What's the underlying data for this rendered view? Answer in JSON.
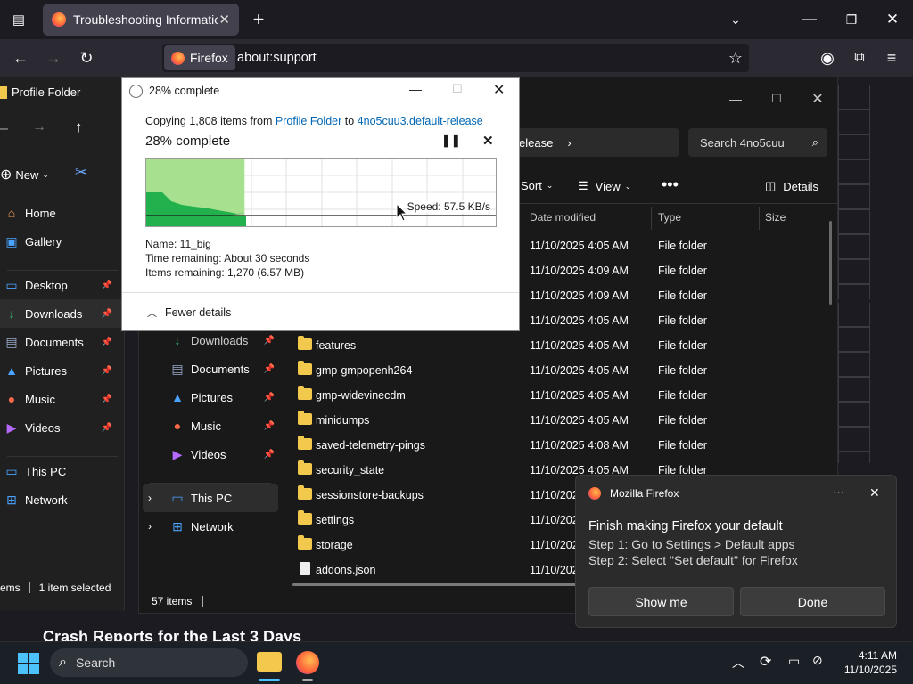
{
  "firefox": {
    "tab_title": "Troubleshooting Information",
    "identity_label": "Firefox",
    "url": "about:support",
    "page_heading": "Crash Reports for the Last 3 Days"
  },
  "explorer_back": {
    "title": "Profile Folder",
    "new_label": "New",
    "nav": [
      {
        "label": "Home",
        "icon": "home-icon"
      },
      {
        "label": "Gallery",
        "icon": "gallery-icon"
      },
      {
        "label": "Desktop",
        "icon": "desktop-icon"
      },
      {
        "label": "Downloads",
        "icon": "download-icon"
      },
      {
        "label": "Documents",
        "icon": "documents-icon"
      },
      {
        "label": "Pictures",
        "icon": "pictures-icon"
      },
      {
        "label": "Music",
        "icon": "music-icon"
      },
      {
        "label": "Videos",
        "icon": "videos-icon"
      },
      {
        "label": "This PC",
        "icon": "pc-icon"
      },
      {
        "label": "Network",
        "icon": "network-icon"
      }
    ],
    "status_items": "ems",
    "status_selected": "1 item selected"
  },
  "explorer_front": {
    "breadcrumb_tail": "elease",
    "search_placeholder": "Search 4no5cuu",
    "sort_label": "Sort",
    "view_label": "View",
    "details_label": "Details",
    "columns": {
      "date": "Date modified",
      "type": "Type",
      "size": "Size"
    },
    "tree": [
      {
        "label": "Downloads",
        "icon": "download-icon"
      },
      {
        "label": "Documents",
        "icon": "documents-icon"
      },
      {
        "label": "Pictures",
        "icon": "pictures-icon"
      },
      {
        "label": "Music",
        "icon": "music-icon"
      },
      {
        "label": "Videos",
        "icon": "videos-icon"
      },
      {
        "label": "This PC",
        "icon": "pc-icon"
      },
      {
        "label": "Network",
        "icon": "network-icon"
      }
    ],
    "rows": [
      {
        "name": "",
        "date": "11/10/2025 4:05 AM",
        "type": "File folder"
      },
      {
        "name": "",
        "date": "11/10/2025 4:09 AM",
        "type": "File folder"
      },
      {
        "name": "",
        "date": "11/10/2025 4:09 AM",
        "type": "File folder"
      },
      {
        "name": "",
        "date": "11/10/2025 4:05 AM",
        "type": "File folder"
      },
      {
        "name": "features",
        "date": "11/10/2025 4:05 AM",
        "type": "File folder"
      },
      {
        "name": "gmp-gmpopenh264",
        "date": "11/10/2025 4:05 AM",
        "type": "File folder"
      },
      {
        "name": "gmp-widevinecdm",
        "date": "11/10/2025 4:05 AM",
        "type": "File folder"
      },
      {
        "name": "minidumps",
        "date": "11/10/2025 4:05 AM",
        "type": "File folder"
      },
      {
        "name": "saved-telemetry-pings",
        "date": "11/10/2025 4:08 AM",
        "type": "File folder"
      },
      {
        "name": "security_state",
        "date": "11/10/2025 4:05 AM",
        "type": "File folder"
      },
      {
        "name": "sessionstore-backups",
        "date": "11/10/202",
        "type": ""
      },
      {
        "name": "settings",
        "date": "11/10/202",
        "type": ""
      },
      {
        "name": "storage",
        "date": "11/10/202",
        "type": ""
      },
      {
        "name": "addons.json",
        "date": "11/10/202",
        "type": ""
      }
    ],
    "status_count": "57 items"
  },
  "copy_dialog": {
    "title": "28% complete",
    "copy_prefix": "Copying 1,808 items from",
    "source": "Profile Folder",
    "to_word": "to",
    "destination": "4no5cuu3.default-release",
    "heading": "28% complete",
    "progress": 0.28,
    "speed": "Speed: 57.5 KB/s",
    "name_line": "Name:  11_big",
    "time_line": "Time remaining:  About 30 seconds",
    "items_line": "Items remaining:  1,270 (6.57 MB)",
    "fewer_details": "Fewer details"
  },
  "toast": {
    "app": "Mozilla Firefox",
    "title": "Finish making Firefox your default",
    "step1": "Step 1: Go to Settings > Default apps",
    "step2": "Step 2: Select \"Set default\" for Firefox",
    "show_me": "Show me",
    "done": "Done"
  },
  "taskbar": {
    "search_label": "Search",
    "time": "4:11 AM",
    "date": "11/10/2025"
  }
}
